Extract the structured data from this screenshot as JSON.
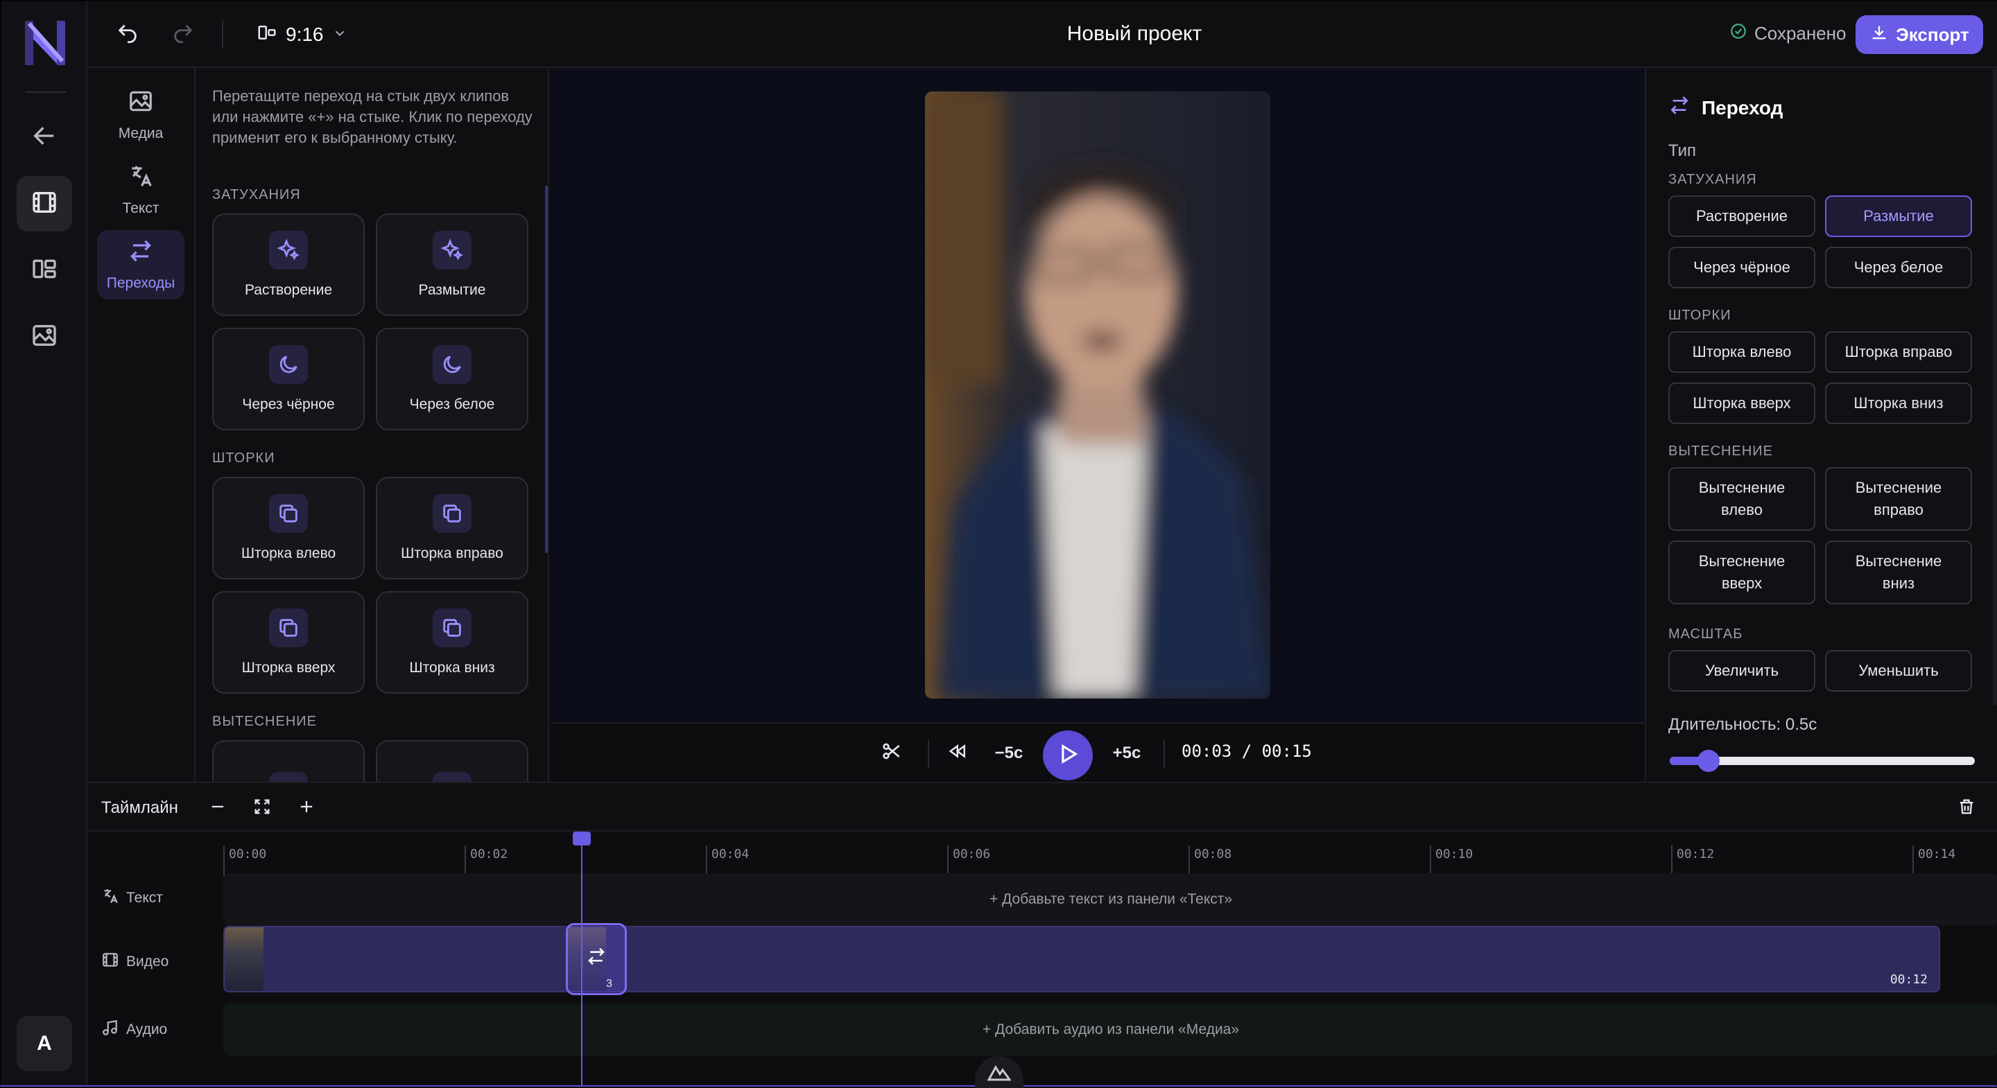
{
  "app": {
    "title": "Новый проект",
    "ratio": "9:16",
    "saved": "Сохранено",
    "export": "Экспорт",
    "avatar": "A"
  },
  "sidenav": [
    {
      "label": "Медиа",
      "icon": "image-icon"
    },
    {
      "label": "Текст",
      "icon": "translate-icon"
    },
    {
      "label": "Переходы",
      "icon": "swap-icon",
      "active": true
    }
  ],
  "left_panel": {
    "help": "Перетащите переход на стык двух клипов или нажмите «+» на стыке. Клик по переходу применит его к выбранному стыку.",
    "sections": [
      {
        "title": "ЗАТУХАНИЯ",
        "items": [
          {
            "label": "Растворение",
            "icon": "sparkles-icon"
          },
          {
            "label": "Размытие",
            "icon": "sparkles-icon"
          },
          {
            "label": "Через чёрное",
            "icon": "moon-icon"
          },
          {
            "label": "Через белое",
            "icon": "moon-icon"
          }
        ]
      },
      {
        "title": "ШТОРКИ",
        "items": [
          {
            "label": "Шторка влево",
            "icon": "copy-icon"
          },
          {
            "label": "Шторка вправо",
            "icon": "copy-icon"
          },
          {
            "label": "Шторка вверх",
            "icon": "copy-icon"
          },
          {
            "label": "Шторка вниз",
            "icon": "copy-icon"
          }
        ]
      },
      {
        "title": "ВЫТЕСНЕНИЕ",
        "items": [
          {
            "label": "",
            "icon": "arrow-right-icon"
          },
          {
            "label": "",
            "icon": "arrow-right-icon"
          }
        ]
      }
    ]
  },
  "player": {
    "back5": "−5с",
    "fwd5": "+5с",
    "time": "00:03 / 00:15"
  },
  "right_panel": {
    "title": "Переход",
    "type_label": "Тип",
    "groups": [
      {
        "title": "ЗАТУХАНИЯ",
        "options": [
          "Растворение",
          "Размытие",
          "Через чёрное",
          "Через белое"
        ],
        "selected": "Размытие"
      },
      {
        "title": "ШТОРКИ",
        "options": [
          "Шторка влево",
          "Шторка вправо",
          "Шторка вверх",
          "Шторка вниз"
        ]
      },
      {
        "title": "ВЫТЕСНЕНИЕ",
        "options": [
          "Вытеснение влево",
          "Вытеснение вправо",
          "Вытеснение вверх",
          "Вытеснение вниз"
        ]
      },
      {
        "title": "МАСШТАБ",
        "options": [
          "Увеличить",
          "Уменьшить"
        ]
      }
    ],
    "duration_label": "Длительность: 0.5с",
    "duration_fraction": 0.09
  },
  "timeline": {
    "title": "Таймлайн",
    "ticks": [
      "00:00",
      "00:02",
      "00:04",
      "00:06",
      "00:08",
      "00:10",
      "00:12",
      "00:14"
    ],
    "tracks": {
      "text": {
        "label": "Текст",
        "placeholder": "+ Добавьте текст из панели «Текст»"
      },
      "video": {
        "label": "Видео",
        "clip_end": "00:12",
        "transition_badge": "3"
      },
      "audio": {
        "label": "Аудио",
        "placeholder": "+ Добавить аудио из панели «Медиа»"
      }
    }
  },
  "colors": {
    "accent": "#6b5ce7",
    "bg": "#0d0d10",
    "selected_bg": "#1e1b36"
  }
}
